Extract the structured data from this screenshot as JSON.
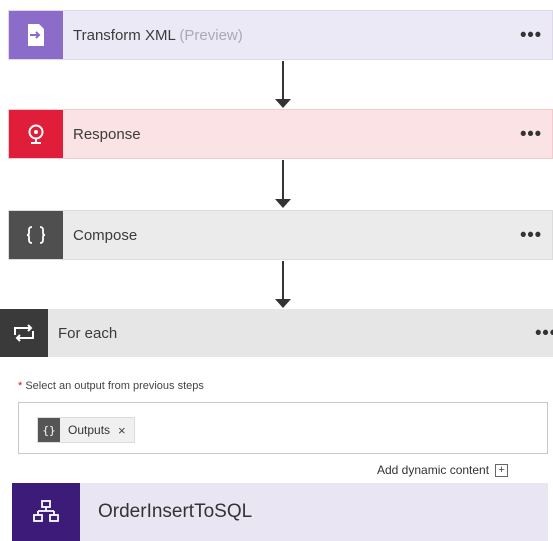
{
  "steps": {
    "transform": {
      "title": "Transform XML",
      "suffix": "(Preview)",
      "menu": "•••",
      "icon": "transform-xml-icon",
      "color": "#8c6cc9"
    },
    "response": {
      "title": "Response",
      "menu": "•••",
      "icon": "response-icon",
      "color": "#e01e3a"
    },
    "compose": {
      "title": "Compose",
      "menu": "•••",
      "icon": "braces-icon",
      "color": "#4f4f4f"
    },
    "foreach": {
      "title": "For each",
      "menu": "•••",
      "icon": "loop-icon",
      "color": "#3a3a3a"
    },
    "order": {
      "title": "OrderInsertToSQL",
      "icon": "hierarchy-icon",
      "color": "#3c1b79"
    }
  },
  "foreach_body": {
    "required_mark": "*",
    "field_label": "Select an output from previous steps",
    "token_icon": "{}",
    "token_label": "Outputs",
    "token_remove": "×",
    "add_dynamic_label": "Add dynamic content",
    "add_dynamic_icon": "+"
  }
}
